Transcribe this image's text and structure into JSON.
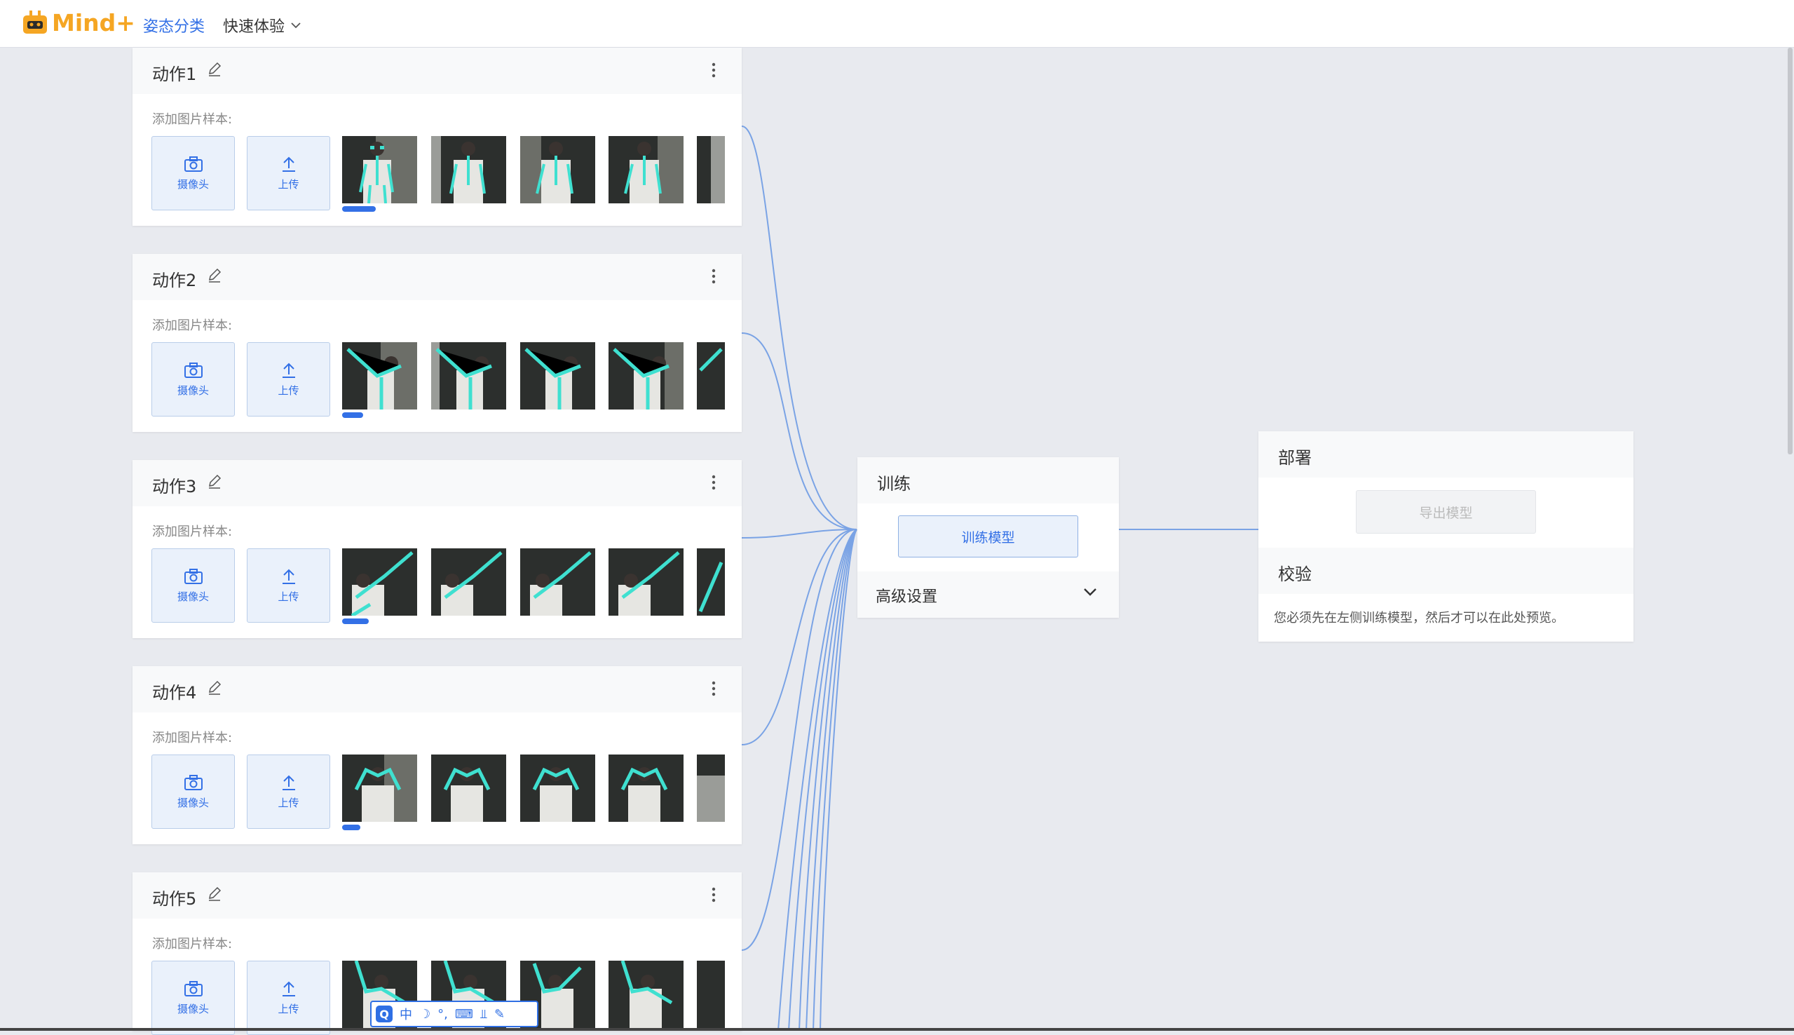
{
  "header": {
    "logo_text": "Mind+",
    "nav_active": "姿态分类",
    "nav_menu": "快速体验"
  },
  "actions": [
    {
      "title": "动作1",
      "sample_label": "添加图片样本:",
      "camera_label": "摄像头",
      "upload_label": "上传"
    },
    {
      "title": "动作2",
      "sample_label": "添加图片样本:",
      "camera_label": "摄像头",
      "upload_label": "上传"
    },
    {
      "title": "动作3",
      "sample_label": "添加图片样本:",
      "camera_label": "摄像头",
      "upload_label": "上传"
    },
    {
      "title": "动作4",
      "sample_label": "添加图片样本:",
      "camera_label": "摄像头",
      "upload_label": "上传"
    },
    {
      "title": "动作5",
      "sample_label": "添加图片样本:",
      "camera_label": "摄像头",
      "upload_label": "上传"
    }
  ],
  "train": {
    "title": "训练",
    "button": "训练模型",
    "advanced": "高级设置"
  },
  "deploy": {
    "title": "部署",
    "export_button": "导出模型",
    "check_title": "校验",
    "check_message": "您必须先在左侧训练模型，然后才可以在此处预览。"
  },
  "ime": {
    "items": [
      "中",
      "☽",
      "°,",
      "⌨",
      "⫫",
      "✎"
    ]
  },
  "colors": {
    "accent": "#3370e6",
    "wire": "#7aa3e5",
    "pose_overlay": "#3fe0d0"
  }
}
